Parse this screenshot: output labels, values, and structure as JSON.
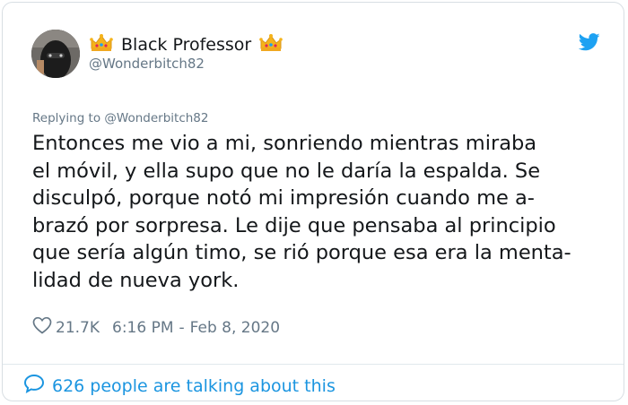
{
  "author": {
    "display_name": "Black Professor",
    "handle": "@Wonderbitch82"
  },
  "tweet": {
    "replying_prefix": "Replying to",
    "replying_handle": "@Wonderbitch82",
    "text": "Entonces me vio a mi, sonriendo mientras miraba\nel móvil, y ella supo que no le daría la espalda. Se\ndisculpó, porque notó mi impresión cuando me a-\nbrazó por sorpresa. Le dije que pensaba al principio\nque sería algún timo, se rió porque esa era la menta-\nlidad de nueva york.",
    "likes": "21.7K",
    "time": "6:16 PM",
    "separator": "-",
    "date": "Feb 8, 2020"
  },
  "footer": {
    "talking_text": "626 people are talking about this"
  },
  "colors": {
    "text": "#14171a",
    "secondary": "#657786",
    "accent": "#1b95e0",
    "twitter_blue": "#1da1f2",
    "crown_gold": "#f5b31a"
  },
  "icons": [
    "crown-icon",
    "twitter-bird-icon",
    "heart-icon",
    "comment-bubble-icon"
  ]
}
